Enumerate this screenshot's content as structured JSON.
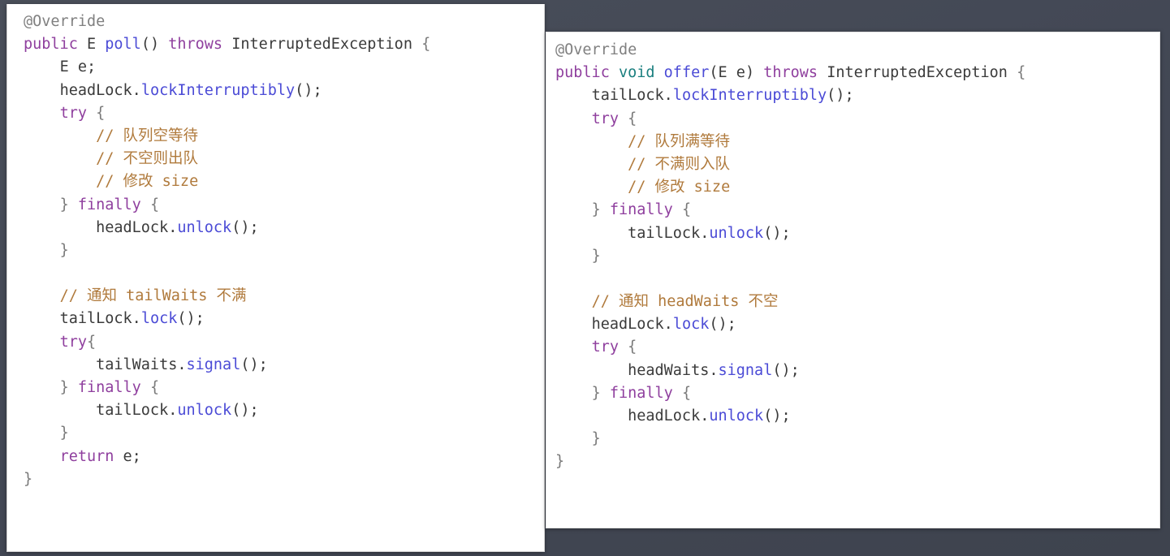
{
  "background_color": "#454a55",
  "panel_background": "#ffffff",
  "theme": {
    "keyword_color": "#8f3f9e",
    "method_color": "#4b4bd6",
    "type_color": "#1a7f7f",
    "comment_color": "#b07a3c",
    "plain_color": "#3b3b3b",
    "annotation_color": "#808080",
    "brace_color": "#7a7a7a"
  },
  "left_panel": {
    "language": "java",
    "method_name": "poll",
    "lines": [
      {
        "id": "l0",
        "text": "@Override",
        "indent": 0
      },
      {
        "id": "l1",
        "text": "public E poll() throws InterruptedException {",
        "indent": 0
      },
      {
        "id": "l2",
        "text": "    E e;",
        "indent": 1
      },
      {
        "id": "l3",
        "text": "    headLock.lockInterruptibly();",
        "indent": 1
      },
      {
        "id": "l4",
        "text": "    try {",
        "indent": 1
      },
      {
        "id": "l5",
        "text": "        // 队列空等待",
        "indent": 2
      },
      {
        "id": "l6",
        "text": "        // 不空则出队",
        "indent": 2
      },
      {
        "id": "l7",
        "text": "        // 修改 size",
        "indent": 2
      },
      {
        "id": "l8",
        "text": "    } finally {",
        "indent": 1
      },
      {
        "id": "l9",
        "text": "        headLock.unlock();",
        "indent": 2
      },
      {
        "id": "l10",
        "text": "    }",
        "indent": 1
      },
      {
        "id": "l11",
        "text": "",
        "indent": 0
      },
      {
        "id": "l12",
        "text": "    // 通知 tailWaits 不满",
        "indent": 1
      },
      {
        "id": "l13",
        "text": "    tailLock.lock();",
        "indent": 1
      },
      {
        "id": "l14",
        "text": "    try{",
        "indent": 1
      },
      {
        "id": "l15",
        "text": "        tailWaits.signal();",
        "indent": 2
      },
      {
        "id": "l16",
        "text": "    } finally {",
        "indent": 1
      },
      {
        "id": "l17",
        "text": "        tailLock.unlock();",
        "indent": 2
      },
      {
        "id": "l18",
        "text": "    }",
        "indent": 1
      },
      {
        "id": "l19",
        "text": "    return e;",
        "indent": 1
      },
      {
        "id": "l20",
        "text": "}",
        "indent": 0
      }
    ]
  },
  "right_panel": {
    "language": "java",
    "method_name": "offer",
    "lines": [
      {
        "id": "r0",
        "text": "@Override",
        "indent": 0
      },
      {
        "id": "r1",
        "text": "public void offer(E e) throws InterruptedException {",
        "indent": 0
      },
      {
        "id": "r2",
        "text": "    tailLock.lockInterruptibly();",
        "indent": 1
      },
      {
        "id": "r3",
        "text": "    try {",
        "indent": 1
      },
      {
        "id": "r4",
        "text": "        // 队列满等待",
        "indent": 2
      },
      {
        "id": "r5",
        "text": "        // 不满则入队",
        "indent": 2
      },
      {
        "id": "r6",
        "text": "        // 修改 size",
        "indent": 2
      },
      {
        "id": "r7",
        "text": "    } finally {",
        "indent": 1
      },
      {
        "id": "r8",
        "text": "        tailLock.unlock();",
        "indent": 2
      },
      {
        "id": "r9",
        "text": "    }",
        "indent": 1
      },
      {
        "id": "r10",
        "text": "",
        "indent": 0
      },
      {
        "id": "r11",
        "text": "    // 通知 headWaits 不空",
        "indent": 1
      },
      {
        "id": "r12",
        "text": "    headLock.lock();",
        "indent": 1
      },
      {
        "id": "r13",
        "text": "    try {",
        "indent": 1
      },
      {
        "id": "r14",
        "text": "        headWaits.signal();",
        "indent": 2
      },
      {
        "id": "r15",
        "text": "    } finally {",
        "indent": 1
      },
      {
        "id": "r16",
        "text": "        headLock.unlock();",
        "indent": 2
      },
      {
        "id": "r17",
        "text": "    }",
        "indent": 1
      },
      {
        "id": "r18",
        "text": "}",
        "indent": 0
      }
    ]
  }
}
